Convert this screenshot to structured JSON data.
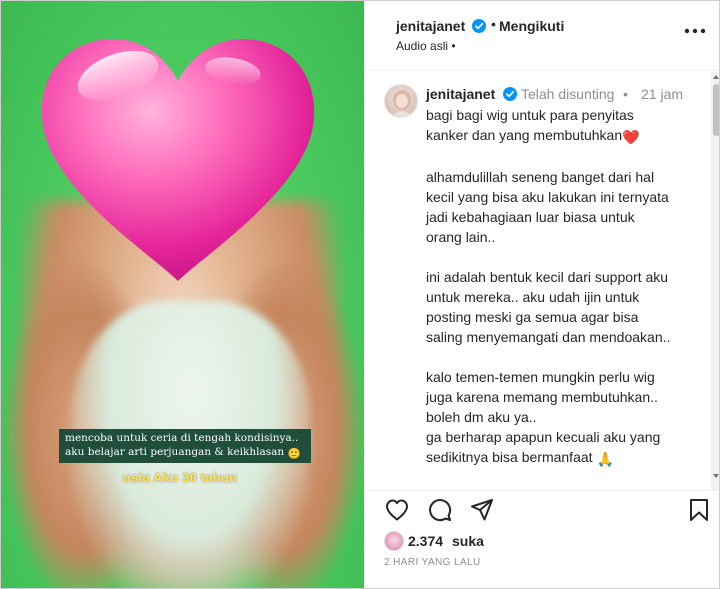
{
  "media": {
    "caption_lines": [
      "mencoba untuk ceria di tengah kondisinya..",
      "aku belajar arti perjuangan & keikhlasan"
    ],
    "caption_emoji": "🙂",
    "overlay_text": "usia Aku 30 tahun",
    "overlay_color": "#ffe24d",
    "background_color": "#4fcf63"
  },
  "header": {
    "username": "jenitajanet",
    "separator": "•",
    "follow_status": "Mengikuti",
    "audio_label": "Audio asli",
    "audio_separator": "•"
  },
  "comment": {
    "username": "jenitajanet",
    "edited_label": "Telah disunting",
    "separator": "•",
    "time": "21 jam",
    "paragraphs": [
      {
        "lines": [
          "bagi bagi wig untuk para penyitas",
          "kanker dan yang membutuhkan"
        ],
        "emoji": "❤️"
      },
      {
        "lines": [
          "alhamdulillah seneng banget dari hal",
          "kecil yang bisa aku lakukan ini ternyata",
          "jadi kebahagiaan luar biasa untuk",
          "orang lain.."
        ]
      },
      {
        "lines": [
          "ini adalah bentuk kecil dari support aku",
          "untuk mereka.. aku udah ijin untuk",
          "posting meski ga semua agar bisa",
          "saling menyemangati dan mendoakan.."
        ]
      },
      {
        "lines": [
          "kalo temen-temen mungkin perlu wig",
          "juga karena memang membutuhkan..",
          "boleh dm aku ya..",
          "ga berharap apapun kecuali aku yang",
          "sedikitnya bisa bermanfaat"
        ],
        "emoji": "🙏"
      },
      {
        "lines": [
          "~~~~~~~"
        ]
      }
    ]
  },
  "actions": {
    "icons": [
      "heart-icon",
      "comment-icon",
      "share-icon",
      "bookmark-icon"
    ],
    "likes_count": "2.374",
    "likes_label": "suka",
    "posted_ago": "2 HARI YANG LALU"
  },
  "colors": {
    "verified": "#0095f6",
    "heart_emoji": "#e0245e",
    "muted_text": "#8e8e8e"
  }
}
